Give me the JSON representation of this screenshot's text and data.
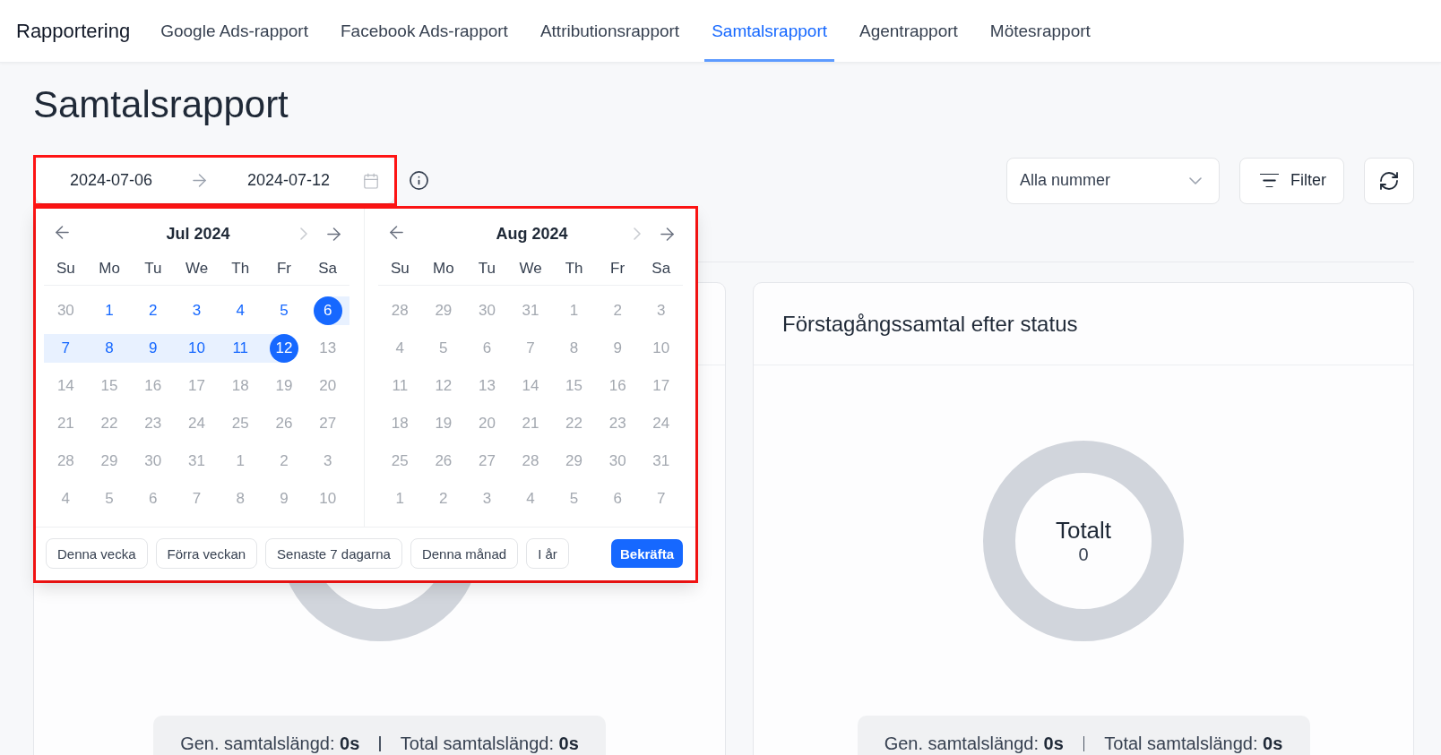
{
  "nav": {
    "brand": "Rapportering",
    "tabs": [
      {
        "label": "Google Ads-rapport",
        "selected": false
      },
      {
        "label": "Facebook Ads-rapport",
        "selected": false
      },
      {
        "label": "Attributionsrapport",
        "selected": false
      },
      {
        "label": "Samtalsrapport",
        "selected": true
      },
      {
        "label": "Agentrapport",
        "selected": false
      },
      {
        "label": "Mötesrapport",
        "selected": false
      }
    ]
  },
  "title": "Samtalsrapport",
  "toolbar": {
    "date_range": {
      "start": "2024-07-06",
      "end": "2024-07-12"
    },
    "number_select": {
      "value": "Alla nummer"
    },
    "filter_button": "Filter"
  },
  "date_picker": {
    "months": [
      {
        "title": "Jul 2024",
        "next_month_disabled": true,
        "weekdays": [
          "Su",
          "Mo",
          "Tu",
          "We",
          "Th",
          "Fr",
          "Sa"
        ],
        "weeks": [
          [
            {
              "label": "30",
              "disabled": true,
              "selected": false,
              "in_range": false
            },
            {
              "label": "1",
              "disabled": false,
              "selected": false,
              "in_range": false
            },
            {
              "label": "2",
              "disabled": false,
              "selected": false,
              "in_range": false
            },
            {
              "label": "3",
              "disabled": false,
              "selected": false,
              "in_range": false
            },
            {
              "label": "4",
              "disabled": false,
              "selected": false,
              "in_range": false
            },
            {
              "label": "5",
              "disabled": false,
              "selected": false,
              "in_range": false
            },
            {
              "label": "6",
              "disabled": false,
              "selected": true,
              "in_range": false
            }
          ],
          [
            {
              "label": "7",
              "disabled": false,
              "selected": false,
              "in_range": true
            },
            {
              "label": "8",
              "disabled": false,
              "selected": false,
              "in_range": true
            },
            {
              "label": "9",
              "disabled": false,
              "selected": false,
              "in_range": true
            },
            {
              "label": "10",
              "disabled": false,
              "selected": false,
              "in_range": true
            },
            {
              "label": "11",
              "disabled": false,
              "selected": false,
              "in_range": true
            },
            {
              "label": "12",
              "disabled": false,
              "selected": true,
              "in_range": false
            },
            {
              "label": "13",
              "disabled": true,
              "selected": false,
              "in_range": false
            }
          ],
          [
            {
              "label": "14",
              "disabled": true,
              "selected": false,
              "in_range": false
            },
            {
              "label": "15",
              "disabled": true,
              "selected": false,
              "in_range": false
            },
            {
              "label": "16",
              "disabled": true,
              "selected": false,
              "in_range": false
            },
            {
              "label": "17",
              "disabled": true,
              "selected": false,
              "in_range": false
            },
            {
              "label": "18",
              "disabled": true,
              "selected": false,
              "in_range": false
            },
            {
              "label": "19",
              "disabled": true,
              "selected": false,
              "in_range": false
            },
            {
              "label": "20",
              "disabled": true,
              "selected": false,
              "in_range": false
            }
          ],
          [
            {
              "label": "21",
              "disabled": true,
              "selected": false,
              "in_range": false
            },
            {
              "label": "22",
              "disabled": true,
              "selected": false,
              "in_range": false
            },
            {
              "label": "23",
              "disabled": true,
              "selected": false,
              "in_range": false
            },
            {
              "label": "24",
              "disabled": true,
              "selected": false,
              "in_range": false
            },
            {
              "label": "25",
              "disabled": true,
              "selected": false,
              "in_range": false
            },
            {
              "label": "26",
              "disabled": true,
              "selected": false,
              "in_range": false
            },
            {
              "label": "27",
              "disabled": true,
              "selected": false,
              "in_range": false
            }
          ],
          [
            {
              "label": "28",
              "disabled": true,
              "selected": false,
              "in_range": false
            },
            {
              "label": "29",
              "disabled": true,
              "selected": false,
              "in_range": false
            },
            {
              "label": "30",
              "disabled": true,
              "selected": false,
              "in_range": false
            },
            {
              "label": "31",
              "disabled": true,
              "selected": false,
              "in_range": false
            },
            {
              "label": "1",
              "disabled": true,
              "selected": false,
              "in_range": false
            },
            {
              "label": "2",
              "disabled": true,
              "selected": false,
              "in_range": false
            },
            {
              "label": "3",
              "disabled": true,
              "selected": false,
              "in_range": false
            }
          ],
          [
            {
              "label": "4",
              "disabled": true,
              "selected": false,
              "in_range": false
            },
            {
              "label": "5",
              "disabled": true,
              "selected": false,
              "in_range": false
            },
            {
              "label": "6",
              "disabled": true,
              "selected": false,
              "in_range": false
            },
            {
              "label": "7",
              "disabled": true,
              "selected": false,
              "in_range": false
            },
            {
              "label": "8",
              "disabled": true,
              "selected": false,
              "in_range": false
            },
            {
              "label": "9",
              "disabled": true,
              "selected": false,
              "in_range": false
            },
            {
              "label": "10",
              "disabled": true,
              "selected": false,
              "in_range": false
            }
          ]
        ]
      },
      {
        "title": "Aug 2024",
        "next_month_disabled": true,
        "weekdays": [
          "Su",
          "Mo",
          "Tu",
          "We",
          "Th",
          "Fr",
          "Sa"
        ],
        "weeks": [
          [
            {
              "label": "28",
              "disabled": true,
              "selected": false,
              "in_range": false
            },
            {
              "label": "29",
              "disabled": true,
              "selected": false,
              "in_range": false
            },
            {
              "label": "30",
              "disabled": true,
              "selected": false,
              "in_range": false
            },
            {
              "label": "31",
              "disabled": true,
              "selected": false,
              "in_range": false
            },
            {
              "label": "1",
              "disabled": true,
              "selected": false,
              "in_range": false
            },
            {
              "label": "2",
              "disabled": true,
              "selected": false,
              "in_range": false
            },
            {
              "label": "3",
              "disabled": true,
              "selected": false,
              "in_range": false
            }
          ],
          [
            {
              "label": "4",
              "disabled": true,
              "selected": false,
              "in_range": false
            },
            {
              "label": "5",
              "disabled": true,
              "selected": false,
              "in_range": false
            },
            {
              "label": "6",
              "disabled": true,
              "selected": false,
              "in_range": false
            },
            {
              "label": "7",
              "disabled": true,
              "selected": false,
              "in_range": false
            },
            {
              "label": "8",
              "disabled": true,
              "selected": false,
              "in_range": false
            },
            {
              "label": "9",
              "disabled": true,
              "selected": false,
              "in_range": false
            },
            {
              "label": "10",
              "disabled": true,
              "selected": false,
              "in_range": false
            }
          ],
          [
            {
              "label": "11",
              "disabled": true,
              "selected": false,
              "in_range": false
            },
            {
              "label": "12",
              "disabled": true,
              "selected": false,
              "in_range": false
            },
            {
              "label": "13",
              "disabled": true,
              "selected": false,
              "in_range": false
            },
            {
              "label": "14",
              "disabled": true,
              "selected": false,
              "in_range": false
            },
            {
              "label": "15",
              "disabled": true,
              "selected": false,
              "in_range": false
            },
            {
              "label": "16",
              "disabled": true,
              "selected": false,
              "in_range": false
            },
            {
              "label": "17",
              "disabled": true,
              "selected": false,
              "in_range": false
            }
          ],
          [
            {
              "label": "18",
              "disabled": true,
              "selected": false,
              "in_range": false
            },
            {
              "label": "19",
              "disabled": true,
              "selected": false,
              "in_range": false
            },
            {
              "label": "20",
              "disabled": true,
              "selected": false,
              "in_range": false
            },
            {
              "label": "21",
              "disabled": true,
              "selected": false,
              "in_range": false
            },
            {
              "label": "22",
              "disabled": true,
              "selected": false,
              "in_range": false
            },
            {
              "label": "23",
              "disabled": true,
              "selected": false,
              "in_range": false
            },
            {
              "label": "24",
              "disabled": true,
              "selected": false,
              "in_range": false
            }
          ],
          [
            {
              "label": "25",
              "disabled": true,
              "selected": false,
              "in_range": false
            },
            {
              "label": "26",
              "disabled": true,
              "selected": false,
              "in_range": false
            },
            {
              "label": "27",
              "disabled": true,
              "selected": false,
              "in_range": false
            },
            {
              "label": "28",
              "disabled": true,
              "selected": false,
              "in_range": false
            },
            {
              "label": "29",
              "disabled": true,
              "selected": false,
              "in_range": false
            },
            {
              "label": "30",
              "disabled": true,
              "selected": false,
              "in_range": false
            },
            {
              "label": "31",
              "disabled": true,
              "selected": false,
              "in_range": false
            }
          ],
          [
            {
              "label": "1",
              "disabled": true,
              "selected": false,
              "in_range": false
            },
            {
              "label": "2",
              "disabled": true,
              "selected": false,
              "in_range": false
            },
            {
              "label": "3",
              "disabled": true,
              "selected": false,
              "in_range": false
            },
            {
              "label": "4",
              "disabled": true,
              "selected": false,
              "in_range": false
            },
            {
              "label": "5",
              "disabled": true,
              "selected": false,
              "in_range": false
            },
            {
              "label": "6",
              "disabled": true,
              "selected": false,
              "in_range": false
            },
            {
              "label": "7",
              "disabled": true,
              "selected": false,
              "in_range": false
            }
          ]
        ]
      }
    ],
    "buttons": [
      {
        "label": "Denna vecka",
        "kind": "preset"
      },
      {
        "label": "Förra veckan",
        "kind": "preset"
      },
      {
        "label": "Senaste 7 dagarna",
        "kind": "preset"
      },
      {
        "label": "Denna månad",
        "kind": "preset"
      },
      {
        "label": "I år",
        "kind": "preset"
      },
      {
        "label": "Bekräfta",
        "kind": "primary"
      }
    ]
  },
  "cards": [
    {
      "chart": {
        "kind": "donut"
      },
      "stats": [
        "Gen. samtalslängd: **0s**",
        "Total samtalslängd: **0s**"
      ]
    },
    {
      "title": "Förstagångssamtal efter status",
      "chart": {
        "kind": "donut",
        "label": "Totalt",
        "value": "0"
      },
      "stats": [
        "Gen. samtalslängd: **0s**",
        "Total samtalslängd: **0s**"
      ]
    }
  ]
}
